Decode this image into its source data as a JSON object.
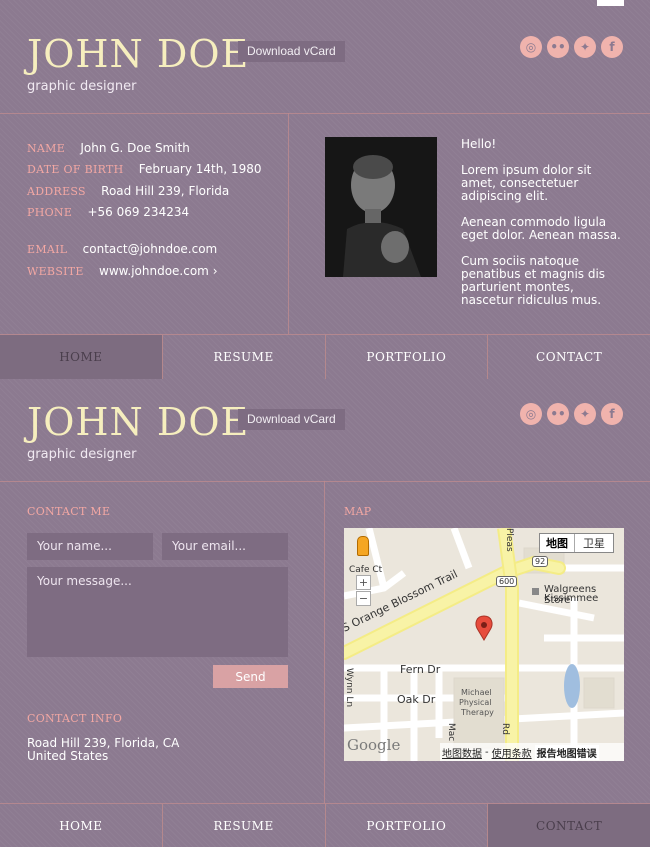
{
  "header": {
    "name": "JOHN DOE",
    "title": "graphic designer",
    "vcard_label": "Download vCard"
  },
  "social": [
    {
      "icon": "dribbble-icon",
      "glyph": "◎"
    },
    {
      "icon": "flickr-icon",
      "glyph": "••"
    },
    {
      "icon": "twitter-icon",
      "glyph": "✦"
    },
    {
      "icon": "facebook-icon",
      "glyph": "f"
    }
  ],
  "profile": {
    "fields": [
      {
        "label": "NAME",
        "value": "John G. Doe Smith"
      },
      {
        "label": "DATE OF BIRTH",
        "value": "February 14th, 1980"
      },
      {
        "label": "ADDRESS",
        "value": "Road Hill 239, Florida"
      },
      {
        "label": "PHONE",
        "value": "+56 069 234234"
      },
      {
        "label": "EMAIL",
        "value": "contact@johndoe.com"
      },
      {
        "label": "WEBSITE",
        "value": "www.johndoe.com ›"
      }
    ],
    "bio": [
      "Hello!",
      "Lorem ipsum dolor sit amet, consectetuer adipiscing elit.",
      "Aenean commodo ligula eget dolor. Aenean massa.",
      "Cum sociis natoque penatibus et magnis dis parturient montes, nascetur ridiculus mus."
    ]
  },
  "nav": {
    "items": [
      "HOME",
      "RESUME",
      "PORTFOLIO",
      "CONTACT"
    ]
  },
  "contact": {
    "heading": "CONTACT ME",
    "name_placeholder": "Your name...",
    "email_placeholder": "Your email...",
    "message_placeholder": "Your message...",
    "send_label": "Send",
    "info_heading": "CONTACT INFO",
    "address_line1": "Road Hill 239, Florida, CA",
    "address_line2": "United States"
  },
  "map": {
    "heading": "MAP",
    "type_map": "地图",
    "type_satellite": "卫星",
    "streets": [
      "S Orange Blossom Trail",
      "Fern Dr",
      "Oak Dr",
      "Cafe Ct",
      "Wynn Ln",
      "Pleas",
      "Mac",
      "Rd"
    ],
    "route_600": "600",
    "route_92": "92",
    "poi_1": "Walgreens Store",
    "poi_2": "Kissimmee",
    "poi_therapy": [
      "Michael",
      "Physical",
      "Therapy"
    ],
    "logo": "Google",
    "footer_data": "地图数据",
    "footer_sep": "-",
    "footer_terms": "使用条款",
    "footer_report": "报告地图错误",
    "zoom_in": "+",
    "zoom_out": "−"
  }
}
